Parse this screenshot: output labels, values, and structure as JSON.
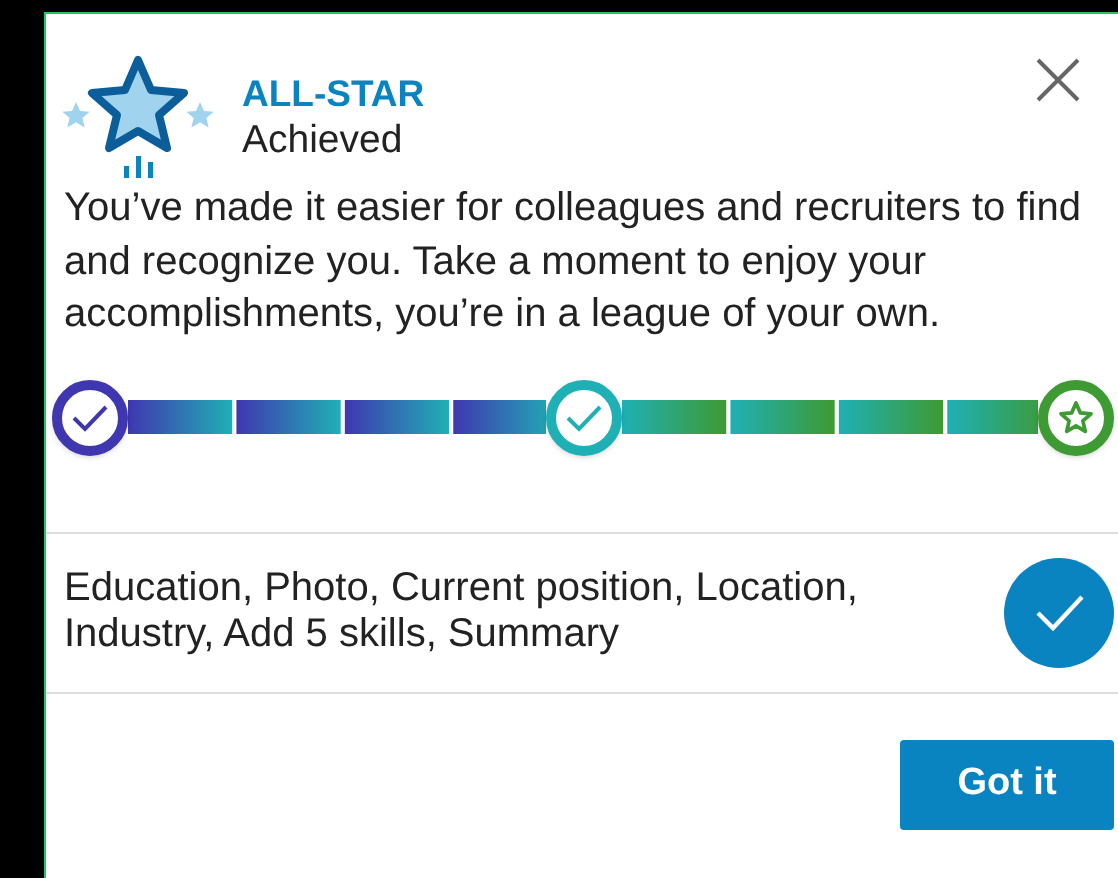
{
  "header": {
    "title": "ALL-STAR",
    "subtitle": "Achieved"
  },
  "description": "You’ve made it easier for colleagues and recruiters to find and recognize you. Take a moment to enjoy your accomplishments, you’re in a league of your own.",
  "progress": {
    "milestones": [
      {
        "kind": "check",
        "color": "#3f37b0"
      },
      {
        "kind": "check",
        "color": "#1fb0b5"
      },
      {
        "kind": "star",
        "color": "#3e9a32"
      }
    ]
  },
  "checklist": {
    "text": "Education, Photo, Current position, Location, Industry, Add 5 skills, Summary",
    "checked": true
  },
  "buttons": [
    {
      "label": "Got it"
    }
  ]
}
